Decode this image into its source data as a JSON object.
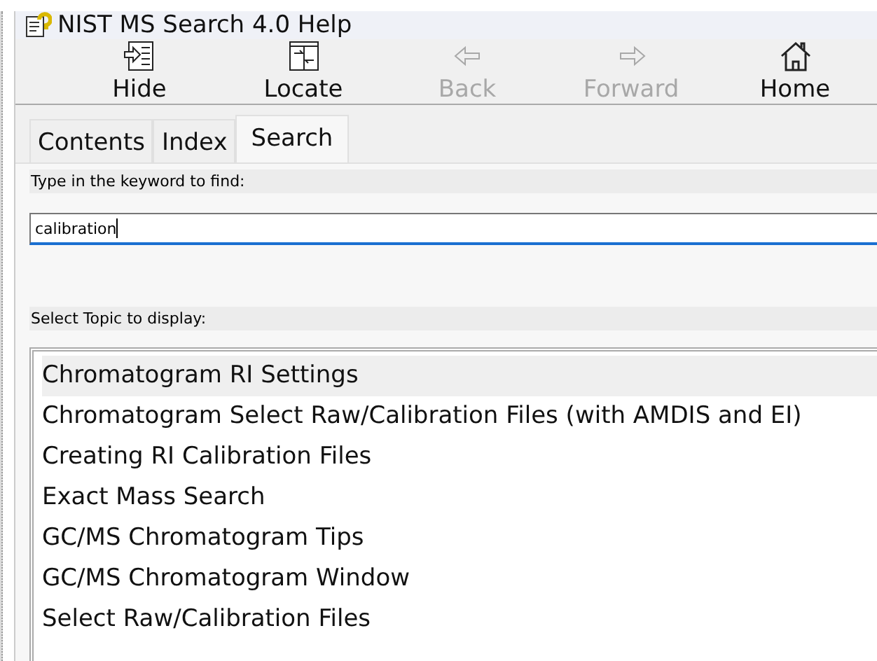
{
  "window": {
    "title": "NIST MS Search 4.0 Help"
  },
  "toolbar": [
    {
      "label": "Hide",
      "kind": "hide",
      "disabled": false
    },
    {
      "label": "Locate",
      "kind": "locate",
      "disabled": false
    },
    {
      "label": "Back",
      "kind": "back",
      "disabled": true
    },
    {
      "label": "Forward",
      "kind": "forward",
      "disabled": true
    },
    {
      "label": "Home",
      "kind": "home",
      "disabled": false
    }
  ],
  "tabs": [
    {
      "label": "Contents",
      "selected": false
    },
    {
      "label": "Index",
      "selected": false
    },
    {
      "label": "Search",
      "selected": true
    }
  ],
  "keyword": {
    "label": "Type in the keyword to find:",
    "value": "calibration"
  },
  "topics": {
    "label": "Select Topic to display:",
    "items": [
      {
        "label": "Chromatogram RI Settings",
        "selected": true
      },
      {
        "label": "Chromatogram Select Raw/Calibration Files (with AMDIS and EI)",
        "selected": false
      },
      {
        "label": "Creating RI Calibration Files",
        "selected": false
      },
      {
        "label": "Exact Mass Search",
        "selected": false
      },
      {
        "label": "GC/MS Chromatogram Tips",
        "selected": false
      },
      {
        "label": "GC/MS Chromatogram Window",
        "selected": false
      },
      {
        "label": "Select Raw/Calibration Files",
        "selected": false
      }
    ]
  }
}
